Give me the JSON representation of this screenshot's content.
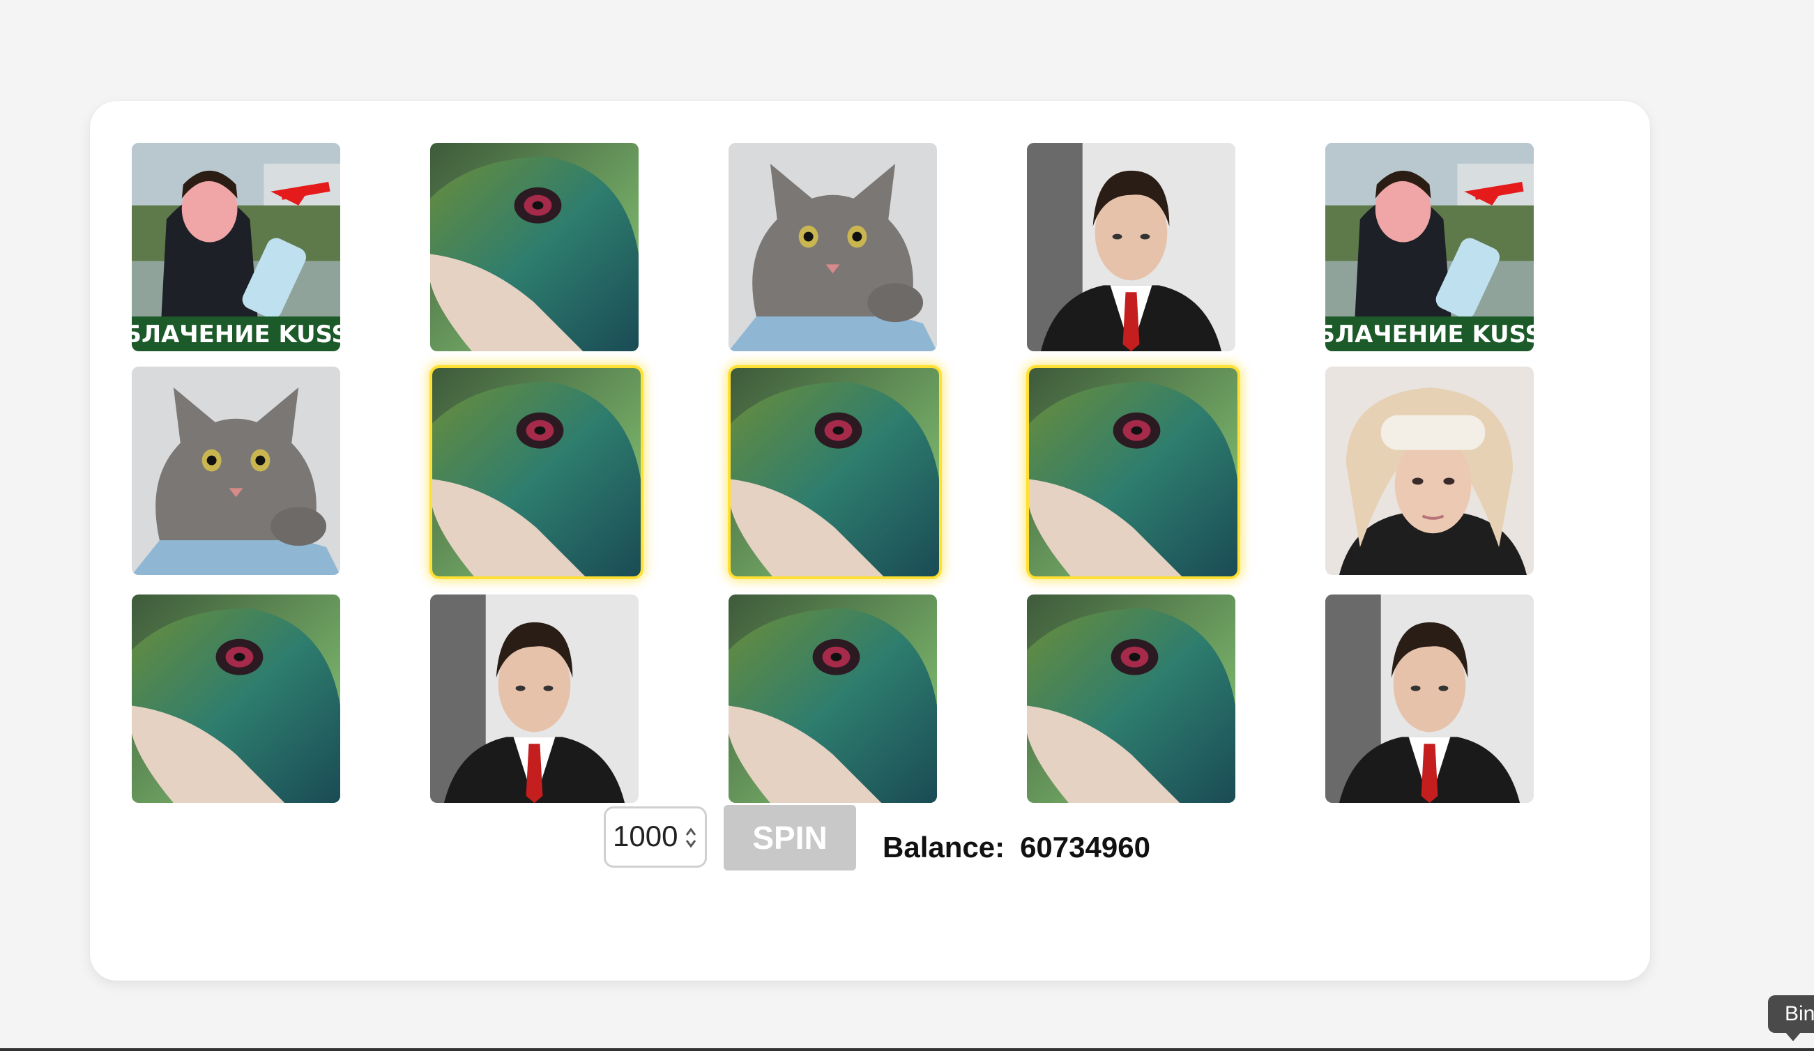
{
  "game": {
    "bet_value": "1000",
    "spin_label": "SPIN",
    "balance_label": "Balance:",
    "balance_value": "60734960",
    "highlight_color": "#ffe033"
  },
  "reels": {
    "symbols": [
      "kuss-poster",
      "lizard",
      "cat",
      "man-in-suit",
      "headband-guy"
    ],
    "poster_caption": "БЛАЧЕНИЕ KUSS",
    "grid": [
      [
        "kuss-poster",
        "lizard",
        "cat",
        "man-in-suit",
        "kuss-poster"
      ],
      [
        "cat",
        "lizard",
        "lizard",
        "lizard",
        "headband-guy"
      ],
      [
        "lizard",
        "man-in-suit",
        "lizard",
        "lizard",
        "man-in-suit"
      ]
    ],
    "winning_line": "row 2, columns 2–4"
  },
  "tooltip": {
    "text": "Bin"
  }
}
